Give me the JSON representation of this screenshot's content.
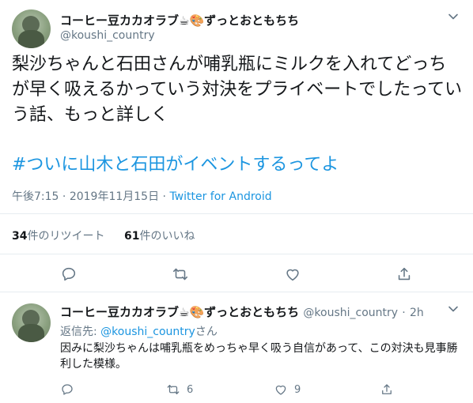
{
  "tweet": {
    "display_name": "コーヒー豆カカオラブ",
    "name_emojis": "☕🎨",
    "name_suffix": "ずっとおともちち",
    "handle": "@koushi_country",
    "text": "梨沙ちゃんと石田さんが哺乳瓶にミルクを入れてどっちが早く吸えるかっていう対決をプライベートでしたっていう話、もっと詳しく",
    "hashtag": "#ついに山木と石田がイベントするってよ",
    "time": "午後7:15",
    "date": "2019年11月15日",
    "separator": "·",
    "app": "Twitter for Android",
    "retweets_count": "34",
    "retweets_label": "件のリツイート",
    "likes_count": "61",
    "likes_label": "件のいいね"
  },
  "reply": {
    "display_name": "コーヒー豆カカオラブ",
    "name_emojis": "☕🎨",
    "name_suffix": "ずっとおともちち",
    "handle": "@koushi_country",
    "separator": "·",
    "age": "2h",
    "reply_to_prefix": "返信先:",
    "reply_to_mention": "@koushi_country",
    "reply_to_suffix": "さん",
    "text": "因みに梨沙ちゃんは哺乳瓶をめっちゃ早く吸う自信があって、この対決も見事勝利した模様。",
    "retweet_count": "6",
    "like_count": "9"
  },
  "colors": {
    "link": "#1b95e0",
    "secondary_text": "#657786",
    "divider": "#e6ecf0"
  },
  "icons": [
    "chevron-down-icon",
    "reply-icon",
    "retweet-icon",
    "like-icon",
    "share-icon",
    "avatar"
  ]
}
